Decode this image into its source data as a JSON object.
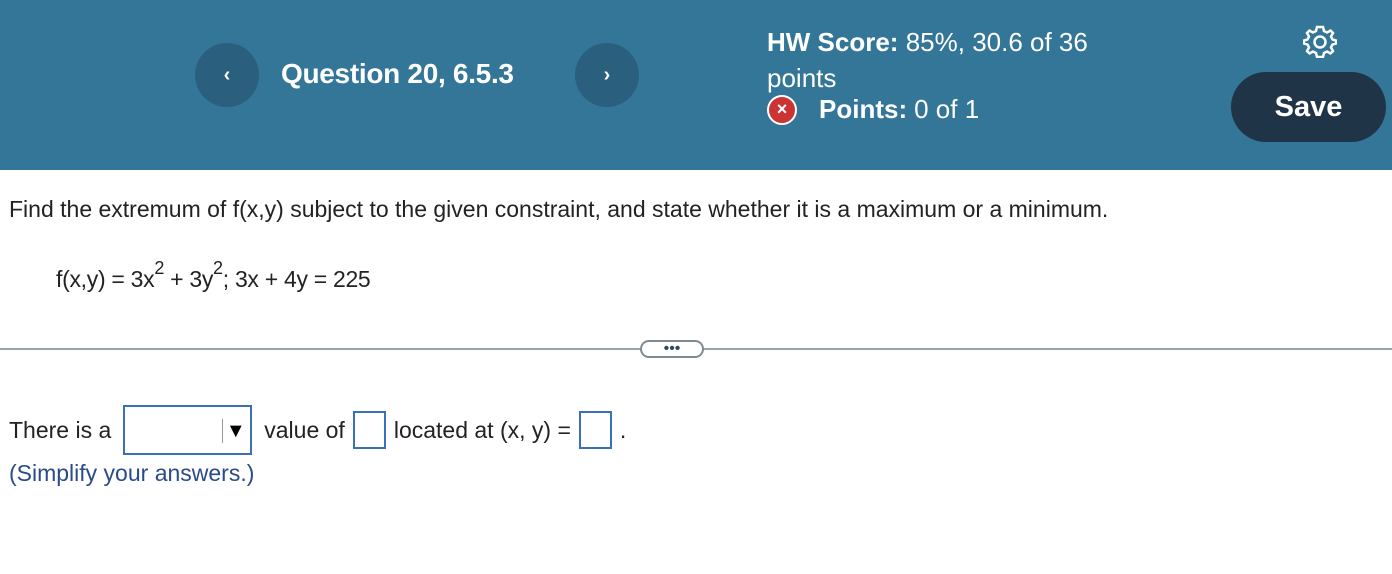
{
  "header": {
    "prev_icon": "‹",
    "next_icon": "›",
    "question_title": "Question 20, 6.5.3",
    "hw_score_label": "HW Score:",
    "hw_score_value": "85%, 30.6 of 36 points",
    "points_label": "Points:",
    "points_value": "0 of 1",
    "points_status_icon": "×",
    "save_label": "Save",
    "gear_icon": "gear-icon"
  },
  "problem": {
    "instruction": "Find the extremum of f(x,y) subject to the given constraint, and state whether it is a maximum or a minimum.",
    "eq_part1": "f(x,y) = 3x",
    "eq_exp1": "2",
    "eq_part2": " + 3y",
    "eq_exp2": "2",
    "eq_part3": "; 3x + 4y = 225"
  },
  "divider": {
    "ellipsis": "•••"
  },
  "answer": {
    "prefix": "There is a",
    "dropdown_value": "",
    "dropdown_arrow": "▼",
    "middle": "value of",
    "located": "located at (x, y) =",
    "end": ".",
    "simplify_note": "(Simplify your answers.)"
  }
}
